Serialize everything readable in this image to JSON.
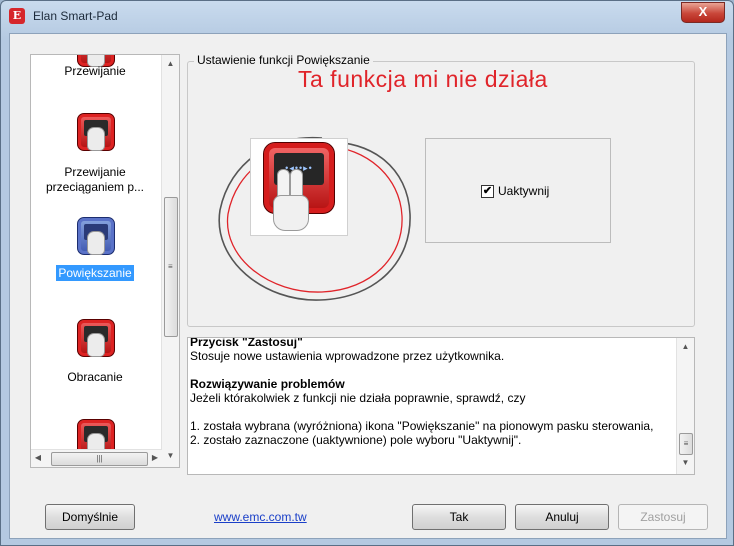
{
  "window": {
    "title": "Elan Smart-Pad",
    "icon": "elan-logo-icon",
    "close_label": "X"
  },
  "sidebar": {
    "items": [
      {
        "label": "Przewijanie",
        "icon": "scroll-icon",
        "selected": false
      },
      {
        "label": "Przewijanie przeciąganiem p...",
        "icon": "drag-scroll-icon",
        "selected": false
      },
      {
        "label": "Powiększanie",
        "icon": "zoom-icon",
        "selected": true
      },
      {
        "label": "Obracanie",
        "icon": "rotate-icon",
        "selected": false
      },
      {
        "label": "",
        "icon": "touchpad-icon",
        "selected": false
      }
    ],
    "scroll_grip": "≡",
    "hscroll_grip": "|||"
  },
  "group": {
    "title": "Ustawienie funkcji Powiększanie"
  },
  "annotation": {
    "text": "Ta funkcja mi nie działa",
    "color": "#e0242a"
  },
  "feature": {
    "icon": "zoom-gesture-icon",
    "dots": "•◂••▸•"
  },
  "checkbox": {
    "label": "Uaktywnij",
    "checked": true,
    "mark": "✔"
  },
  "help": {
    "lines": [
      {
        "text": "Przycisk \"Zastosuj\"",
        "bold": true
      },
      {
        "text": "Stosuje nowe ustawienia wprowadzone przez użytkownika.",
        "bold": false
      },
      {
        "text": "",
        "bold": false
      },
      {
        "text": "Rozwiązywanie problemów",
        "bold": true
      },
      {
        "text": "Jeżeli którakolwiek z funkcji nie działa poprawnie, sprawdź, czy",
        "bold": false
      },
      {
        "text": "",
        "bold": false
      },
      {
        "text": "1. została wybrana (wyróżniona) ikona \"Powiększanie\" na pionowym pasku sterowania,",
        "bold": false
      },
      {
        "text": "2. zostało zaznaczone (uaktywnione) pole wyboru \"Uaktywnij\".",
        "bold": false
      }
    ]
  },
  "footer": {
    "defaults_label": "Domyślnie",
    "link_text": "www.emc.com.tw",
    "ok_label": "Tak",
    "cancel_label": "Anuluj",
    "apply_label": "Zastosuj"
  }
}
